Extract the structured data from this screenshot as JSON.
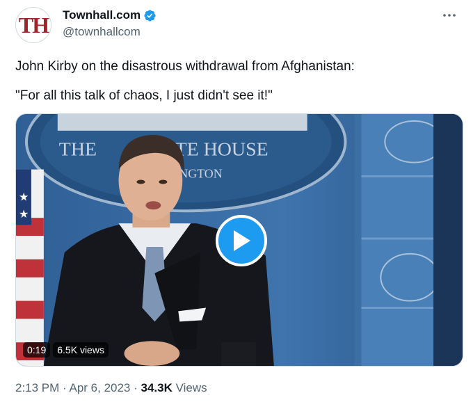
{
  "author": {
    "avatar_text": "TH",
    "display_name": "Townhall.com",
    "handle": "@townhallcom",
    "verified_icon": "verified-badge-icon"
  },
  "tweet": {
    "line1": "John Kirby on the disastrous withdrawal from Afghanistan:",
    "line2": "\"For all this talk of chaos, I just didn't see it!\""
  },
  "video": {
    "duration": "0:19",
    "views": "6.5K views",
    "seal_text_left": "THE",
    "seal_text_right": "ITE HOUSE",
    "seal_text_sub": "NGTON",
    "play_icon": "play-icon"
  },
  "meta": {
    "time": "2:13 PM",
    "sep1": " · ",
    "date": "Apr 6, 2023",
    "sep2": " · ",
    "view_count": "34.3K",
    "view_label": " Views"
  },
  "colors": {
    "accent": "#1d9bf0",
    "secondary_text": "#536471",
    "brand_red": "#a3242b"
  }
}
